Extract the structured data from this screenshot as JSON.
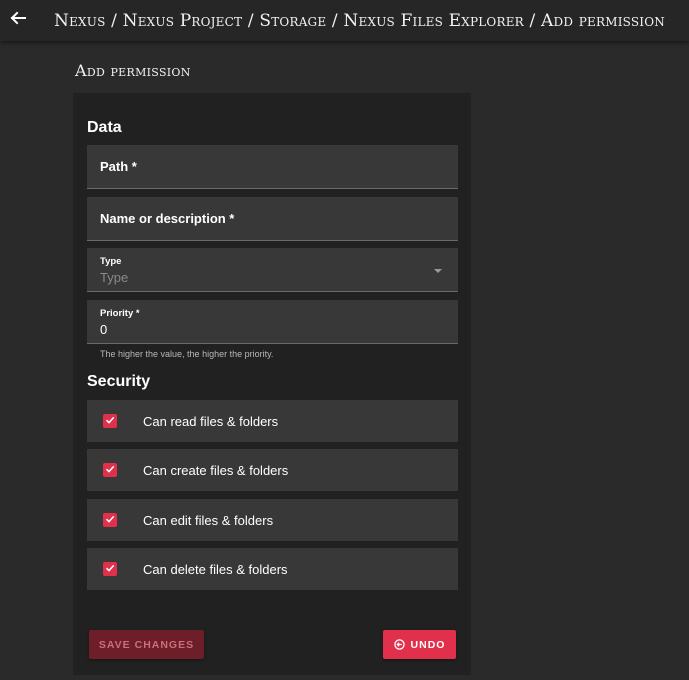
{
  "header": {
    "back_icon": "arrow-left-icon",
    "breadcrumb": "Nexus / Nexus Project / Storage / Nexus Files Explorer / Add permission"
  },
  "page": {
    "title": "Add permission"
  },
  "data_section": {
    "title": "Data",
    "path": {
      "label": "Path *",
      "value": ""
    },
    "name": {
      "label": "Name or description *",
      "value": ""
    },
    "type": {
      "label": "Type",
      "placeholder": "Type",
      "icon": "dropdown-arrow-icon"
    },
    "priority": {
      "label": "Priority *",
      "value": "0",
      "hint": "The higher the value, the higher the priority."
    }
  },
  "security_section": {
    "title": "Security",
    "items": [
      {
        "label": "Can read files & folders",
        "checked": true
      },
      {
        "label": "Can create files & folders",
        "checked": true
      },
      {
        "label": "Can edit files & folders",
        "checked": true
      },
      {
        "label": "Can delete files & folders",
        "checked": true
      }
    ]
  },
  "actions": {
    "save_label": "SAVE CHANGES",
    "undo_label": "UNDO",
    "undo_icon": "undo-icon"
  },
  "colors": {
    "accent": "#e0304b",
    "save_disabled_bg": "#6e1e28",
    "background": "#2a2a2a",
    "card": "#212121",
    "field": "#383838"
  }
}
